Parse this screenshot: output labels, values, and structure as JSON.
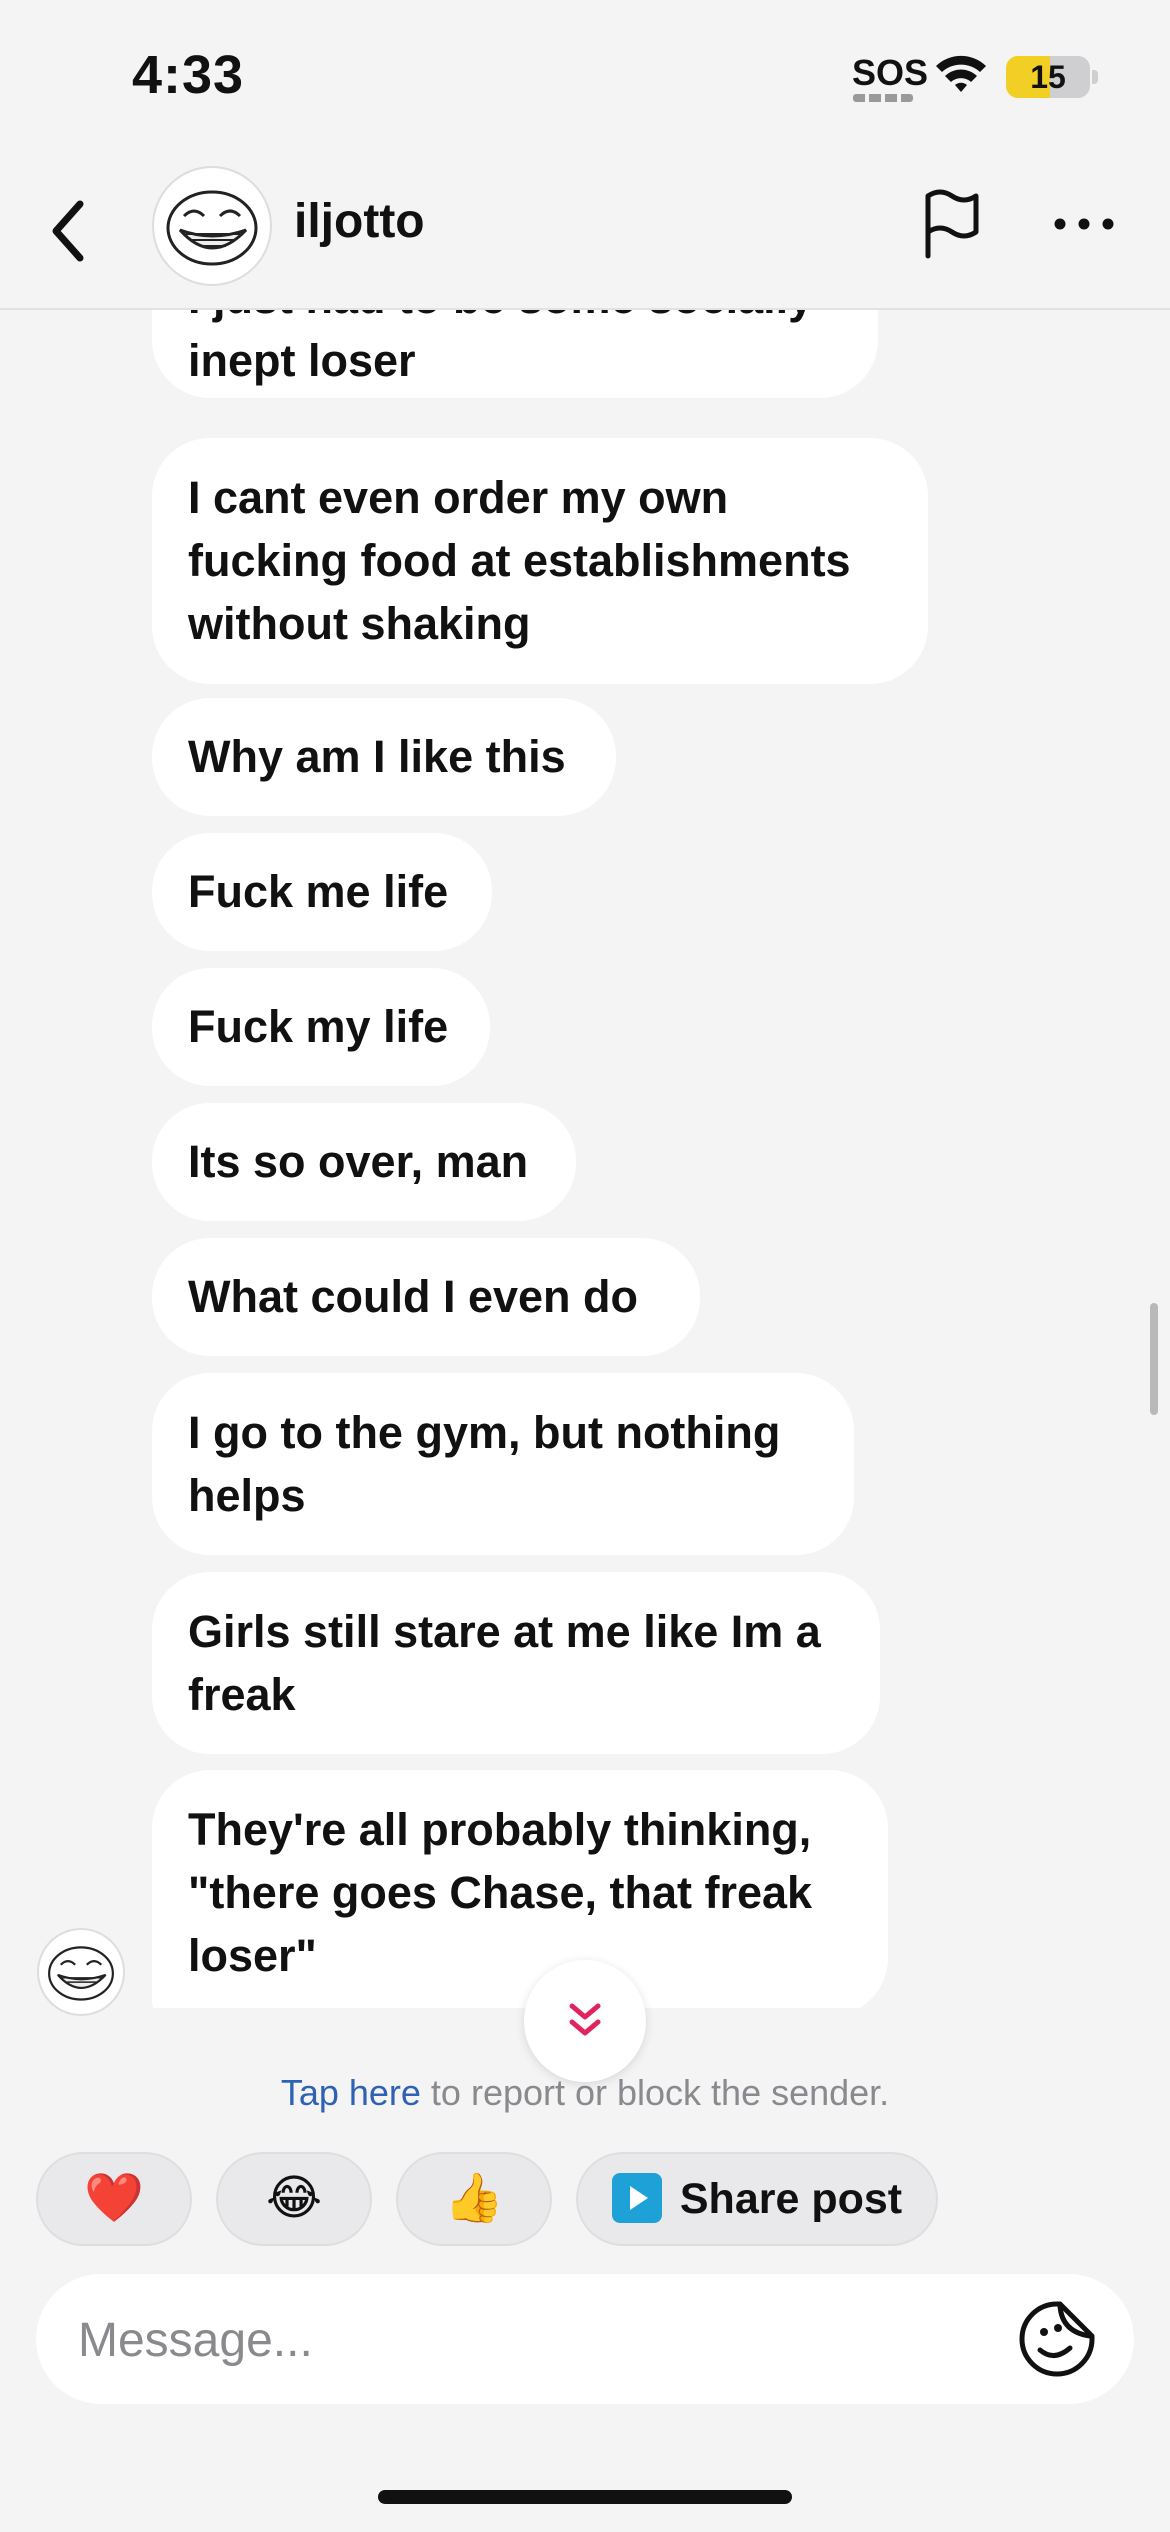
{
  "status_bar": {
    "time": "4:33",
    "sos": "SOS",
    "battery": "15",
    "battery_color": "#f2cf25"
  },
  "header": {
    "username": "iljotto",
    "back_icon": "chevron-left-icon",
    "flag_icon": "flag-icon",
    "more_icon": "more-horizontal-icon"
  },
  "messages": [
    {
      "text": "I just had to be some socially inept loser"
    },
    {
      "text": "I cant even order my own fucking food at establishments without shaking"
    },
    {
      "text": "Why am I like this"
    },
    {
      "text": "Fuck me life"
    },
    {
      "text": "Fuck my life"
    },
    {
      "text": "Its so over, man"
    },
    {
      "text": "What could I even do"
    },
    {
      "text": "I go to the gym, but nothing helps"
    },
    {
      "text": "Girls still stare at me like Im a freak"
    },
    {
      "text": "They're all probably thinking, \"there goes Chase, that freak loser\""
    }
  ],
  "report": {
    "link": "Tap here",
    "rest": " to report or block the sender."
  },
  "reactions": {
    "heart": "❤️",
    "laugh": "😂",
    "thumbs": "👍",
    "share_label": "Share post"
  },
  "composer": {
    "placeholder": "Message..."
  },
  "colors": {
    "accent_link": "#2f62b4",
    "jump_arrow": "#e0245e",
    "background": "#f4f4f5"
  }
}
